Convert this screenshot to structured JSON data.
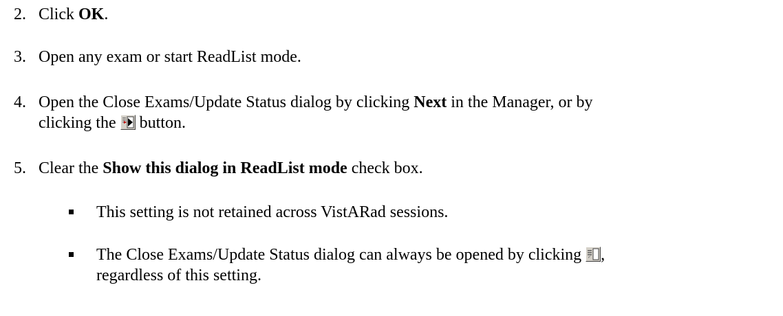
{
  "steps": [
    {
      "number": "2.",
      "parts": [
        "Click ",
        "OK",
        "."
      ]
    },
    {
      "number": "3.",
      "text": "Open any exam or start ReadList mode."
    },
    {
      "number": "4.",
      "line1_a": "Open the Close Exams/Update Status dialog by clicking ",
      "line1_bold": "Next",
      "line1_b": " in the Manager, or by",
      "line2_a": "clicking the ",
      "line2_b": " button."
    },
    {
      "number": "5.",
      "a": "Clear the ",
      "bold": "Show this dialog in ReadList mode",
      "b": " check box."
    }
  ],
  "bullets": [
    {
      "text": "This setting is not retained across VistARad sessions."
    },
    {
      "line1": "The Close Exams/Update Status dialog can always be opened by clicking ",
      "line1_end": ",",
      "line2": "regardless of this setting."
    }
  ],
  "icons": {
    "next_exam_button": "next-exam-arrow-icon",
    "close_exams_button": "close-exams-icon"
  }
}
